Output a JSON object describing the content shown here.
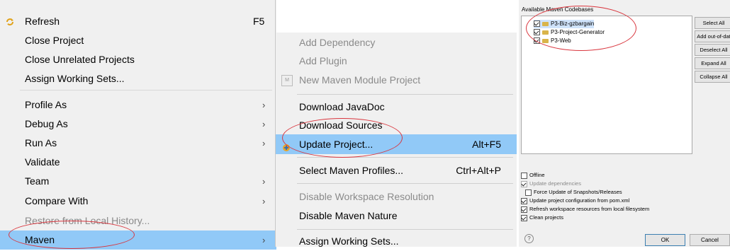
{
  "context_menu": {
    "items": [
      {
        "label": "Refresh",
        "accel": "F5"
      },
      {
        "label": "Close Project"
      },
      {
        "label": "Close Unrelated Projects"
      },
      {
        "label": "Assign Working Sets..."
      },
      {
        "label": "Profile As",
        "arrow": "›"
      },
      {
        "label": "Debug As",
        "arrow": "›"
      },
      {
        "label": "Run As",
        "arrow": "›"
      },
      {
        "label": "Validate"
      },
      {
        "label": "Team",
        "arrow": "›"
      },
      {
        "label": "Compare With",
        "arrow": "›"
      },
      {
        "label": "Restore from Local History..."
      },
      {
        "label": "Maven",
        "arrow": "›"
      }
    ]
  },
  "maven_submenu": {
    "items": [
      {
        "label": "Add Dependency"
      },
      {
        "label": "Add Plugin"
      },
      {
        "label": "New Maven Module Project"
      },
      {
        "label": "Download JavaDoc"
      },
      {
        "label": "Download Sources"
      },
      {
        "label": "Update Project...",
        "accel": "Alt+F5"
      },
      {
        "label": "Select Maven Profiles...",
        "accel": "Ctrl+Alt+P"
      },
      {
        "label": "Disable Workspace Resolution"
      },
      {
        "label": "Disable Maven Nature"
      },
      {
        "label": "Assign Working Sets..."
      }
    ]
  },
  "dialog": {
    "codebases_title": "Available Maven Codebases",
    "codebases": [
      "P3-Biz-gzbargain",
      "P3-Project-Generator",
      "P3-Web"
    ],
    "buttons": [
      "Select All",
      "Add out-of-dat",
      "Deselect All",
      "Expand All",
      "Collapse All"
    ],
    "options": [
      {
        "label": "Offline",
        "checked": false
      },
      {
        "label": "Update dependencies",
        "checked": true,
        "disabled": true
      },
      {
        "label": "Force Update of Snapshots/Releases",
        "checked": false
      },
      {
        "label": "Update project configuration from pom.xml",
        "checked": true
      },
      {
        "label": "Refresh workspace resources from local filesystem",
        "checked": true
      },
      {
        "label": "Clean projects",
        "checked": true
      }
    ],
    "ok_label": "OK",
    "cancel_label": "Cancel",
    "help_glyph": "?"
  }
}
